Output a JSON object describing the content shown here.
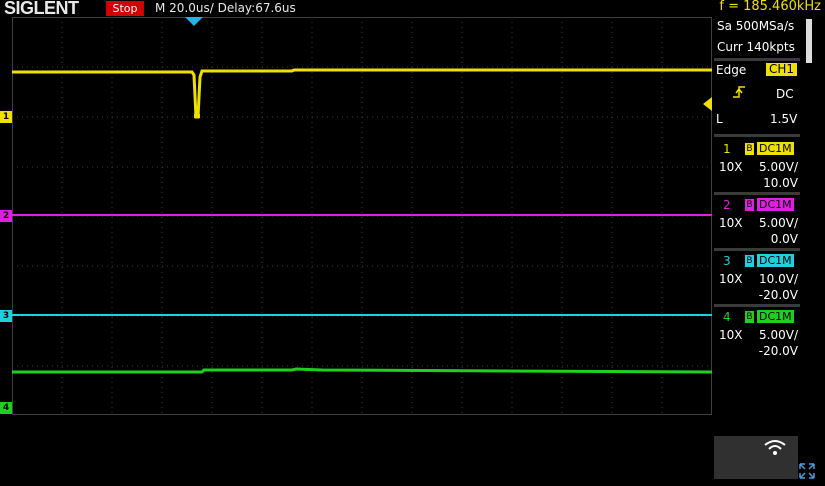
{
  "header": {
    "brand": "SIGLENT",
    "run_state": "Stop",
    "timebase": "M 20.0us/",
    "delay": "Delay:67.6us",
    "frequency": "f = 185.460kHz"
  },
  "acquisition": {
    "sample_rate": "Sa 500MSa/s",
    "memory": "Curr 140kpts"
  },
  "trigger": {
    "type": "Edge",
    "source": "CH1",
    "slope_icon": "rising-edge-icon",
    "coupling": "DC",
    "mode": "L",
    "level": "1.5V"
  },
  "channels": [
    {
      "num": "1",
      "mark": "B",
      "coupling": "DC1M",
      "probe": "10X",
      "scale": "5.00V/",
      "offset": "10.0V",
      "color": "#f0e000"
    },
    {
      "num": "2",
      "mark": "B",
      "coupling": "DC1M",
      "probe": "10X",
      "scale": "5.00V/",
      "offset": "0.0V",
      "color": "#e020e0"
    },
    {
      "num": "3",
      "mark": "B",
      "coupling": "DC1M",
      "probe": "10X",
      "scale": "10.0V/",
      "offset": "-20.0V",
      "color": "#20d0e0"
    },
    {
      "num": "4",
      "mark": "B",
      "coupling": "DC1M",
      "probe": "10X",
      "scale": "5.00V/",
      "offset": "-20.0V",
      "color": "#20d020"
    }
  ],
  "markers": {
    "ch1": "1",
    "ch2": "2",
    "ch3": "3",
    "ch4": "4"
  },
  "colors": {
    "ch1": "#f0e000",
    "ch2": "#e020e0",
    "ch3": "#20d0e0",
    "ch4": "#20d020",
    "trigger": "#2bb0e8",
    "stop": "#d20000"
  }
}
